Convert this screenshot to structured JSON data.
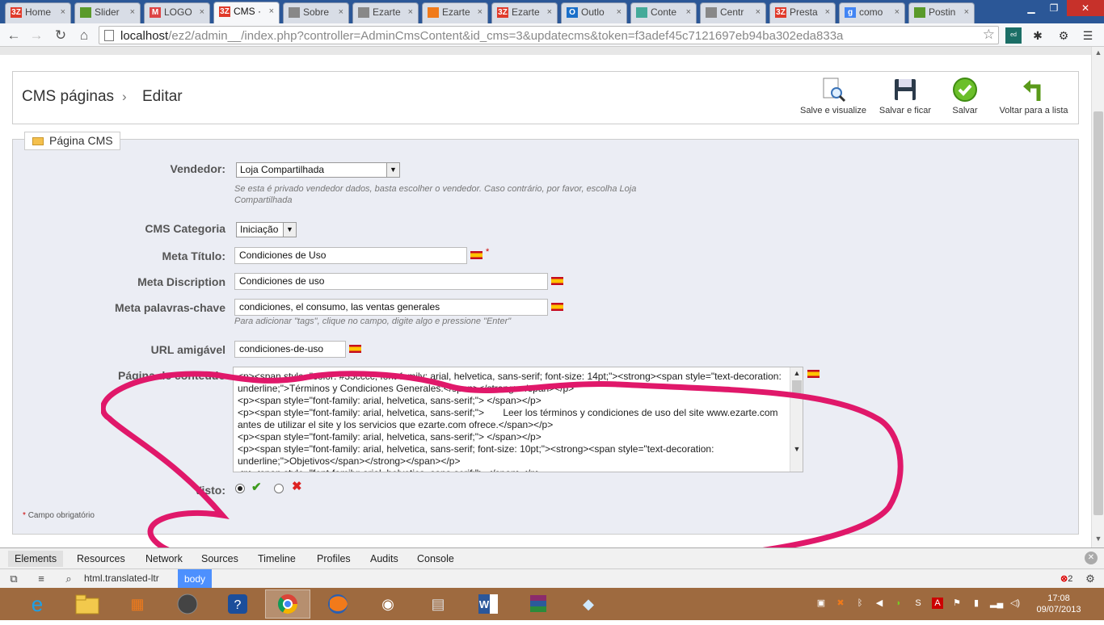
{
  "browser": {
    "tabs": [
      {
        "label": "Home",
        "icon": "3Z",
        "color": "#e03a2a"
      },
      {
        "label": "Slider",
        "icon": "leaf",
        "color": "#5a9a2a"
      },
      {
        "label": "LOGO",
        "icon": "M",
        "color": "#d44"
      },
      {
        "label": "CMS ·",
        "icon": "3Z",
        "color": "#e03a2a",
        "active": true
      },
      {
        "label": "Sobre",
        "icon": "doc",
        "color": "#888"
      },
      {
        "label": "Ezarte",
        "icon": "doc",
        "color": "#888"
      },
      {
        "label": "Ezarte",
        "icon": "box",
        "color": "#f07a1a"
      },
      {
        "label": "Ezarte",
        "icon": "3Z",
        "color": "#e03a2a"
      },
      {
        "label": "Outlo",
        "icon": "O",
        "color": "#1a6fc9"
      },
      {
        "label": "Conte",
        "icon": "win",
        "color": "#4a9"
      },
      {
        "label": "Centr",
        "icon": "doc",
        "color": "#888"
      },
      {
        "label": "Presta",
        "icon": "3Z",
        "color": "#e03a2a"
      },
      {
        "label": "como",
        "icon": "g",
        "color": "#4285f4"
      },
      {
        "label": "Postin",
        "icon": "leaf",
        "color": "#5a9a2a"
      }
    ],
    "url_host": "localhost",
    "url_path": "/ez2/admin__/index.php?controller=AdminCmsContent&id_cms=3&updatecms&token=f3adef45c7121697eb94ba302eda833a"
  },
  "breadcrumb": {
    "section": "CMS páginas",
    "separator": "›",
    "current": "Editar"
  },
  "toolbar": {
    "save_preview": "Salve e visualize",
    "save_stay": "Salvar e ficar",
    "save": "Salvar",
    "back": "Voltar para a lista"
  },
  "form": {
    "legend": "Página CMS",
    "vendor": {
      "label": "Vendedor:",
      "value": "Loja Compartilhada",
      "hint": "Se esta é privado vendedor dados, basta escolher o vendedor. Caso contrário, por favor, escolha Loja Compartilhada"
    },
    "category": {
      "label": "CMS Categoria",
      "value": "Iniciação"
    },
    "meta_title": {
      "label": "Meta Título:",
      "value": "Condiciones de Uso",
      "required": "*"
    },
    "meta_description": {
      "label": "Meta Discription",
      "value": "Condiciones de uso"
    },
    "meta_keywords": {
      "label": "Meta palavras-chave",
      "value": "condiciones, el consumo, las ventas generales",
      "hint": "Para adicionar \"tags\", clique no campo, digite algo e pressione \"Enter\""
    },
    "friendly_url": {
      "label": "URL amigável",
      "value": "condiciones-de-uso"
    },
    "content": {
      "label": "Página de conteúdo",
      "text": "<p><span style=\"color: #33cccc; font-family: arial, helvetica, sans-serif; font-size: 14pt;\"><strong><span style=\"text-decoration: underline;\">Términos y Condiciones Generales:</span></strong></span></p>\n<p><span style=\"font-family: arial, helvetica, sans-serif;\"> </span></p>\n<p><span style=\"font-family: arial, helvetica, sans-serif;\">       Leer los términos y condiciones de uso del site www.ezarte.com  antes de utilizar el site y los servicios que ezarte.com ofrece.</span></p>\n<p><span style=\"font-family: arial, helvetica, sans-serif;\"> </span></p>\n<p><span style=\"font-family: arial, helvetica, sans-serif; font-size: 10pt;\"><strong><span style=\"text-decoration: underline;\">Objetivos</span></strong></span></p>\n<p><span style=\"font-family: arial, helvetica, sans-serif;\"> </span></p>"
    },
    "visible": {
      "label": "Visto:"
    },
    "required_note": "Campo obrigatório",
    "required_star": "*"
  },
  "devtools": {
    "tabs": [
      "Elements",
      "Resources",
      "Network",
      "Sources",
      "Timeline",
      "Profiles",
      "Audits",
      "Console"
    ],
    "path": "html.translated-ltr",
    "body": "body",
    "errors": "2"
  },
  "clock": {
    "time": "17:08",
    "date": "09/07/2013"
  },
  "colors": {
    "annotation": "#e0186a",
    "active_tab": "#49b2f3"
  }
}
